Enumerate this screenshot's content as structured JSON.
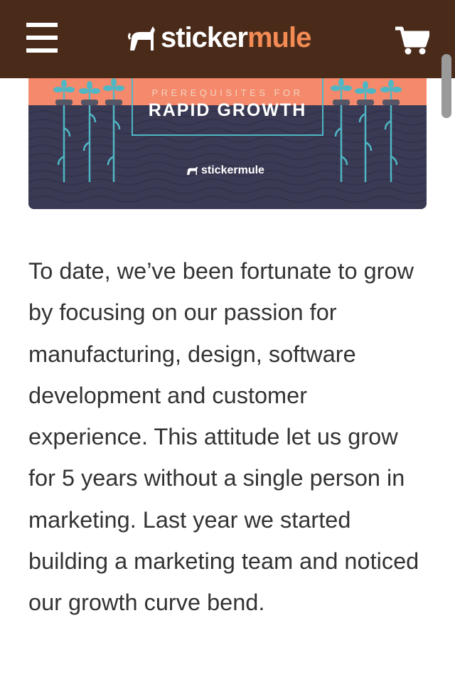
{
  "header": {
    "logo_part1": "sticker",
    "logo_part2": "mule",
    "bg_color": "#4a2b1a",
    "accent_color": "#f48b55",
    "menu_icon": "hamburger-menu-icon",
    "cart_icon": "shopping-cart-icon"
  },
  "banner": {
    "prefix": "PREREQUISITES FOR",
    "title": "RAPID GROWTH",
    "brand": "stickermule",
    "colors": {
      "sky": "#f4896b",
      "waves": "#3a3a55",
      "plant": "#4fb6c4"
    }
  },
  "article": {
    "paragraph": "To date, we’ve been fortunate to grow by focusing on our passion for manufacturing, design, software development and customer experience. This attitude let us grow for 5 years without a single person in marketing. Last year we started building a marketing team and noticed our growth curve bend."
  }
}
